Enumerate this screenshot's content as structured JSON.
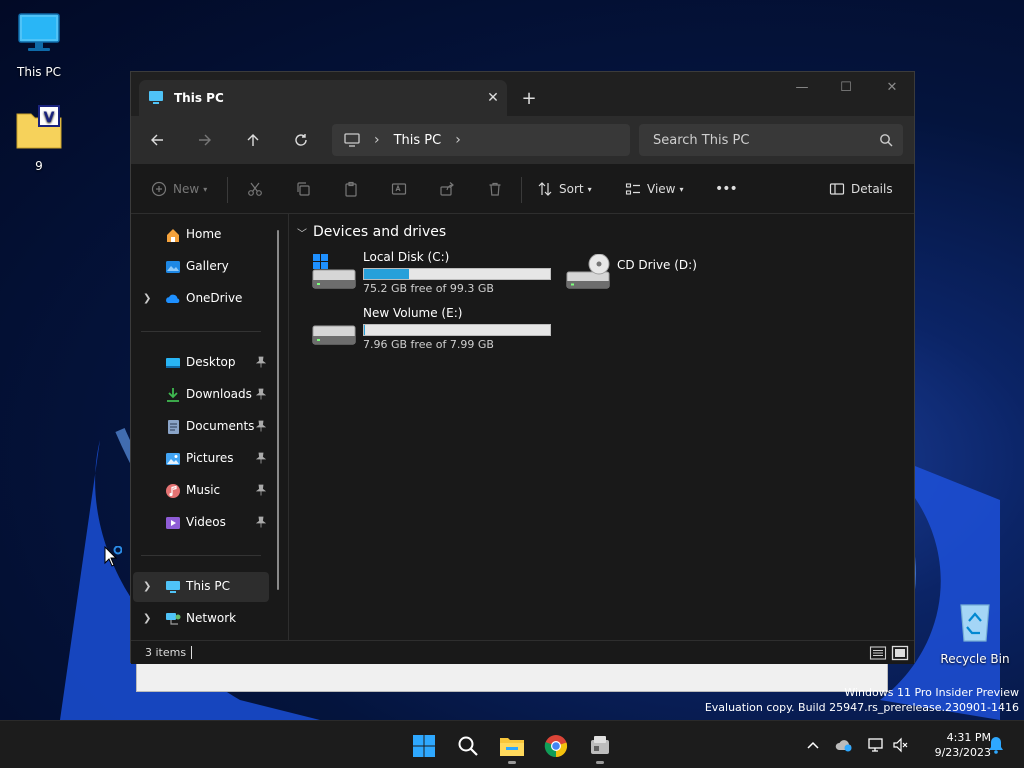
{
  "desktop": {
    "icons": [
      {
        "label": "This PC",
        "icon": "computer-icon"
      },
      {
        "label": "9",
        "icon": "folder-icon"
      },
      {
        "label": "Recycle Bin",
        "icon": "recycle-bin-icon"
      }
    ]
  },
  "window": {
    "tab_title": "This PC",
    "new_tab": "+",
    "address_crumbs": [
      "This PC"
    ],
    "search_placeholder": "Search This PC",
    "commands": {
      "new": "New",
      "sort": "Sort",
      "view": "View",
      "more": "•••",
      "details": "Details"
    },
    "sidebar": {
      "quick": [
        {
          "label": "Home",
          "icon": "home-icon"
        },
        {
          "label": "Gallery",
          "icon": "gallery-icon"
        },
        {
          "label": "OneDrive",
          "icon": "onedrive-icon"
        }
      ],
      "pinned": [
        {
          "label": "Desktop",
          "icon": "desktop-folder-icon"
        },
        {
          "label": "Downloads",
          "icon": "downloads-icon"
        },
        {
          "label": "Documents",
          "icon": "documents-icon"
        },
        {
          "label": "Pictures",
          "icon": "pictures-icon"
        },
        {
          "label": "Music",
          "icon": "music-icon"
        },
        {
          "label": "Videos",
          "icon": "videos-icon"
        }
      ],
      "locations": [
        {
          "label": "This PC",
          "icon": "this-pc-icon"
        },
        {
          "label": "Network",
          "icon": "network-icon"
        }
      ]
    },
    "group_title": "Devices and drives",
    "drives": [
      {
        "name": "Local Disk (C:)",
        "free": "75.2 GB free of 99.3 GB",
        "used_fraction": 0.243,
        "icon": "windows-drive-icon"
      },
      {
        "name": "CD Drive (D:)",
        "icon": "cd-drive-icon"
      },
      {
        "name": "New Volume (E:)",
        "free": "7.96 GB free of 7.99 GB",
        "used_fraction": 0.004,
        "icon": "drive-icon"
      }
    ],
    "status": "3 items"
  },
  "watermark": {
    "line1": "Windows 11 Pro Insider Preview",
    "line2": "Evaluation copy. Build 25947.rs_prerelease.230901-1416"
  },
  "taskbar": {
    "apps": [
      "start-icon",
      "search-icon",
      "file-explorer-icon",
      "chrome-icon",
      "app-icon"
    ],
    "time": "4:31 PM",
    "date": "9/23/2023"
  },
  "colors": {
    "accent": "#26a0da",
    "window_bg": "#191919",
    "toolbar_bg": "#2c2c2c",
    "taskbar_bg": "#1c1c1c"
  }
}
